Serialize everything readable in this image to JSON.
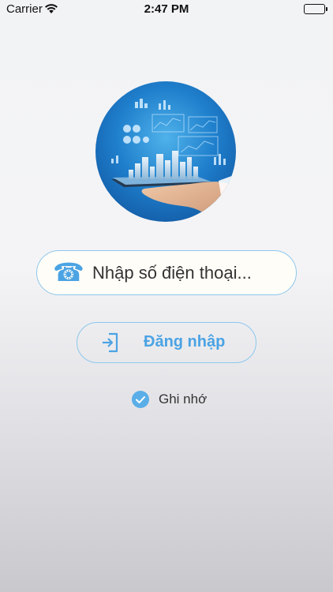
{
  "status_bar": {
    "carrier": "Carrier",
    "time": "2:47 PM",
    "icons": [
      "wifi-icon",
      "battery-icon"
    ]
  },
  "logo": {
    "icon": "hand-holding-tablet-city-logo"
  },
  "phone_input": {
    "placeholder": "Nhập số điện thoại...",
    "value": "",
    "icon": "telephone-icon"
  },
  "login_button": {
    "label": "Đăng nhập",
    "icon": "login-icon"
  },
  "remember": {
    "label": "Ghi nhớ",
    "checked": true
  },
  "colors": {
    "accent": "#4ba3e3",
    "border": "#8cc7ec",
    "checkbox": "#5aaee8"
  }
}
